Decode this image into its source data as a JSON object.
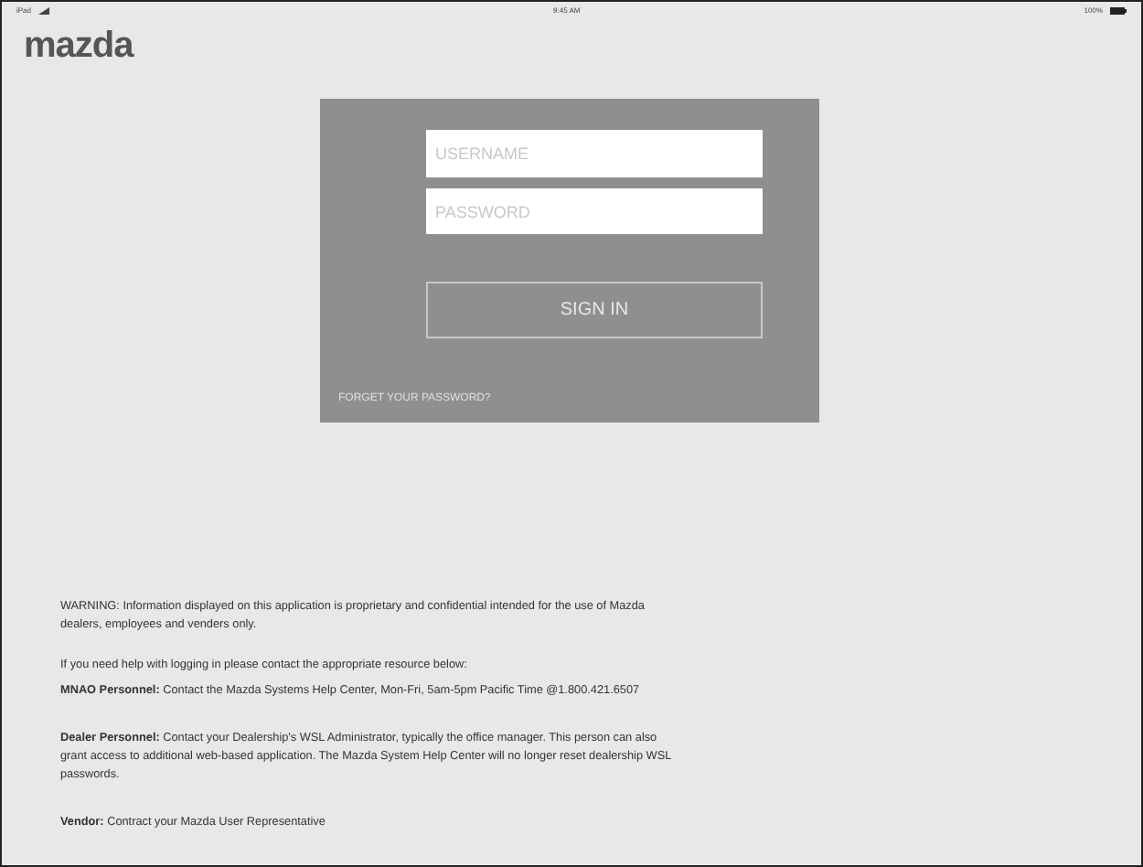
{
  "status_bar": {
    "carrier": "iPad",
    "time": "9:45 AM",
    "battery": "100%"
  },
  "logo": "mazda",
  "login": {
    "username": {
      "placeholder": "USERNAME"
    },
    "password": {
      "placeholder": "PASSWORD"
    },
    "button": "SIGN IN",
    "forgot_link": "FORGET YOUR PASSWORD?"
  },
  "notices": [
    "WARNING: Information displayed on this application is proprietary and confidential intended for the use of Mazda dealers, employees and venders only.",
    "If you need help with logging in please contact the appropriate resource below:",
    "**MNAO Personnel:** Contact the Mazda Systems Help Center, Mon-Fri, 5am-5pm Pacific Time @1.800.421.6507",
    "**Dealer Personnel:** Contact your Dealership's WSL Administrator, typically the office manager. This person can also grant access to additional web-based application. The Mazda System Help Center will no longer reset dealership WSL passwords.",
    "**Vendor:** Contract your Mazda User Representative"
  ]
}
